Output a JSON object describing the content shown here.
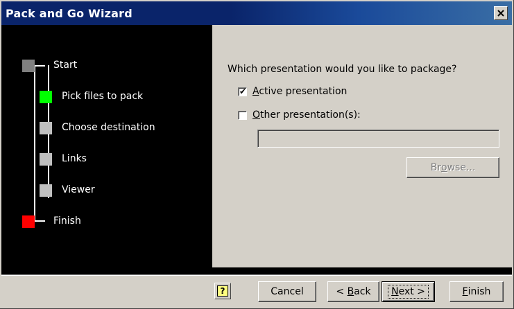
{
  "window": {
    "title": "Pack and Go Wizard",
    "close_glyph": "✕"
  },
  "steps": [
    {
      "label": "Start",
      "color": "#808080",
      "state": "done"
    },
    {
      "label": "Pick files to pack",
      "color": "#00ff00",
      "state": "current"
    },
    {
      "label": "Choose destination",
      "color": "#c0c0c0",
      "state": "pending"
    },
    {
      "label": "Links",
      "color": "#c0c0c0",
      "state": "pending"
    },
    {
      "label": "Viewer",
      "color": "#c0c0c0",
      "state": "pending"
    },
    {
      "label": "Finish",
      "color": "#ff0000",
      "state": "end"
    }
  ],
  "content": {
    "question": "Which presentation would you like to package?",
    "option_active": {
      "label_first": "A",
      "label_rest": "ctive presentation",
      "checked": true
    },
    "option_other": {
      "label_first": "O",
      "label_rest": "ther presentation(s):",
      "checked": false
    },
    "other_path_value": "",
    "browse_label_a": "Br",
    "browse_label_u": "o",
    "browse_label_b": "wse..."
  },
  "footer": {
    "help_glyph": "?",
    "cancel_label": "Cancel",
    "back_prefix": "< ",
    "back_u": "B",
    "back_rest": "ack",
    "next_u": "N",
    "next_rest": "ext >",
    "finish_u": "F",
    "finish_rest": "inish"
  }
}
